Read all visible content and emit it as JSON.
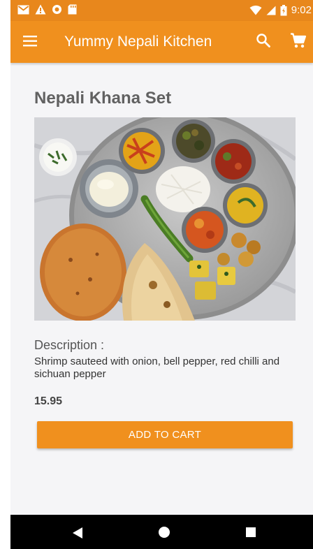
{
  "status_bar": {
    "time": "9:02",
    "left_icons": [
      "mail-icon",
      "warning-icon",
      "record-icon",
      "sd-card-icon"
    ],
    "right_icons": [
      "wifi-icon",
      "signal-icon",
      "battery-icon"
    ]
  },
  "app_bar": {
    "title": "Yummy Nepali Kitchen",
    "icons": [
      "menu-icon",
      "search-icon",
      "cart-icon"
    ]
  },
  "product": {
    "title": "Nepali Khana Set",
    "description_label": "Description :",
    "description": "Shrimp sauteed with onion, bell pepper, red chilli and sichuan pepper",
    "price": "15.95",
    "add_to_cart_label": "ADD TO CART"
  },
  "nav_bar": {
    "icons": [
      "back-icon",
      "home-icon",
      "recent-apps-icon"
    ]
  },
  "colors": {
    "status_bar": "#e8871c",
    "primary": "#f0901e",
    "background": "#f5f5f7",
    "nav_bar": "#000000"
  }
}
